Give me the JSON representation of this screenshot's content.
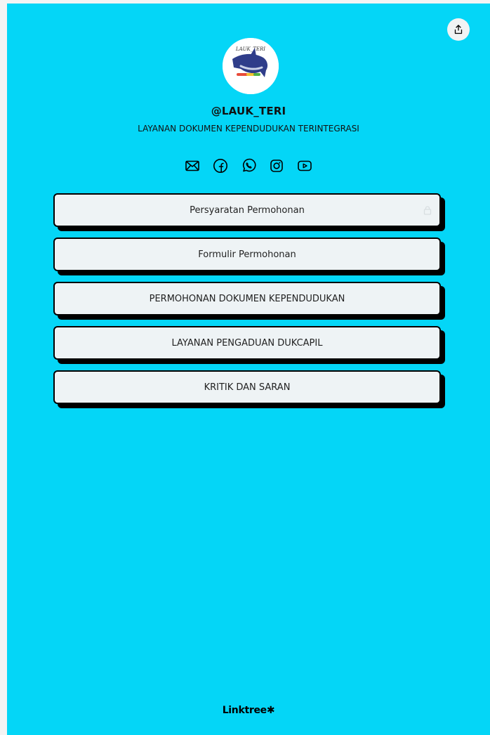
{
  "profile": {
    "handle": "@LAUK_TERI",
    "bio": "LAYANAN DOKUMEN KEPENDUDUKAN TERINTEGRASI",
    "avatar": {
      "icon": "dolphin-logo",
      "text": "LAUK_TERI"
    }
  },
  "share": {
    "icon": "share-icon"
  },
  "socials": [
    {
      "name": "email",
      "icon": "email-icon"
    },
    {
      "name": "facebook",
      "icon": "facebook-icon"
    },
    {
      "name": "whatsapp",
      "icon": "whatsapp-icon"
    },
    {
      "name": "instagram",
      "icon": "instagram-icon"
    },
    {
      "name": "youtube",
      "icon": "youtube-icon"
    }
  ],
  "links": [
    {
      "label": "Persyaratan Permohonan",
      "locked": true
    },
    {
      "label": "Formulir Permohonan"
    },
    {
      "label": "PERMOHONAN DOKUMEN KEPENDUDUKAN"
    },
    {
      "label": "LAYANAN PENGADUAN DUKCAPIL"
    },
    {
      "label": "KRITIK DAN SARAN"
    }
  ],
  "footer": {
    "brand": "Linktree",
    "mark": "✱"
  },
  "colors": {
    "background": "#04d6f7",
    "button_bg": "#eef3f5",
    "button_border": "#000000",
    "text": "#111111"
  }
}
